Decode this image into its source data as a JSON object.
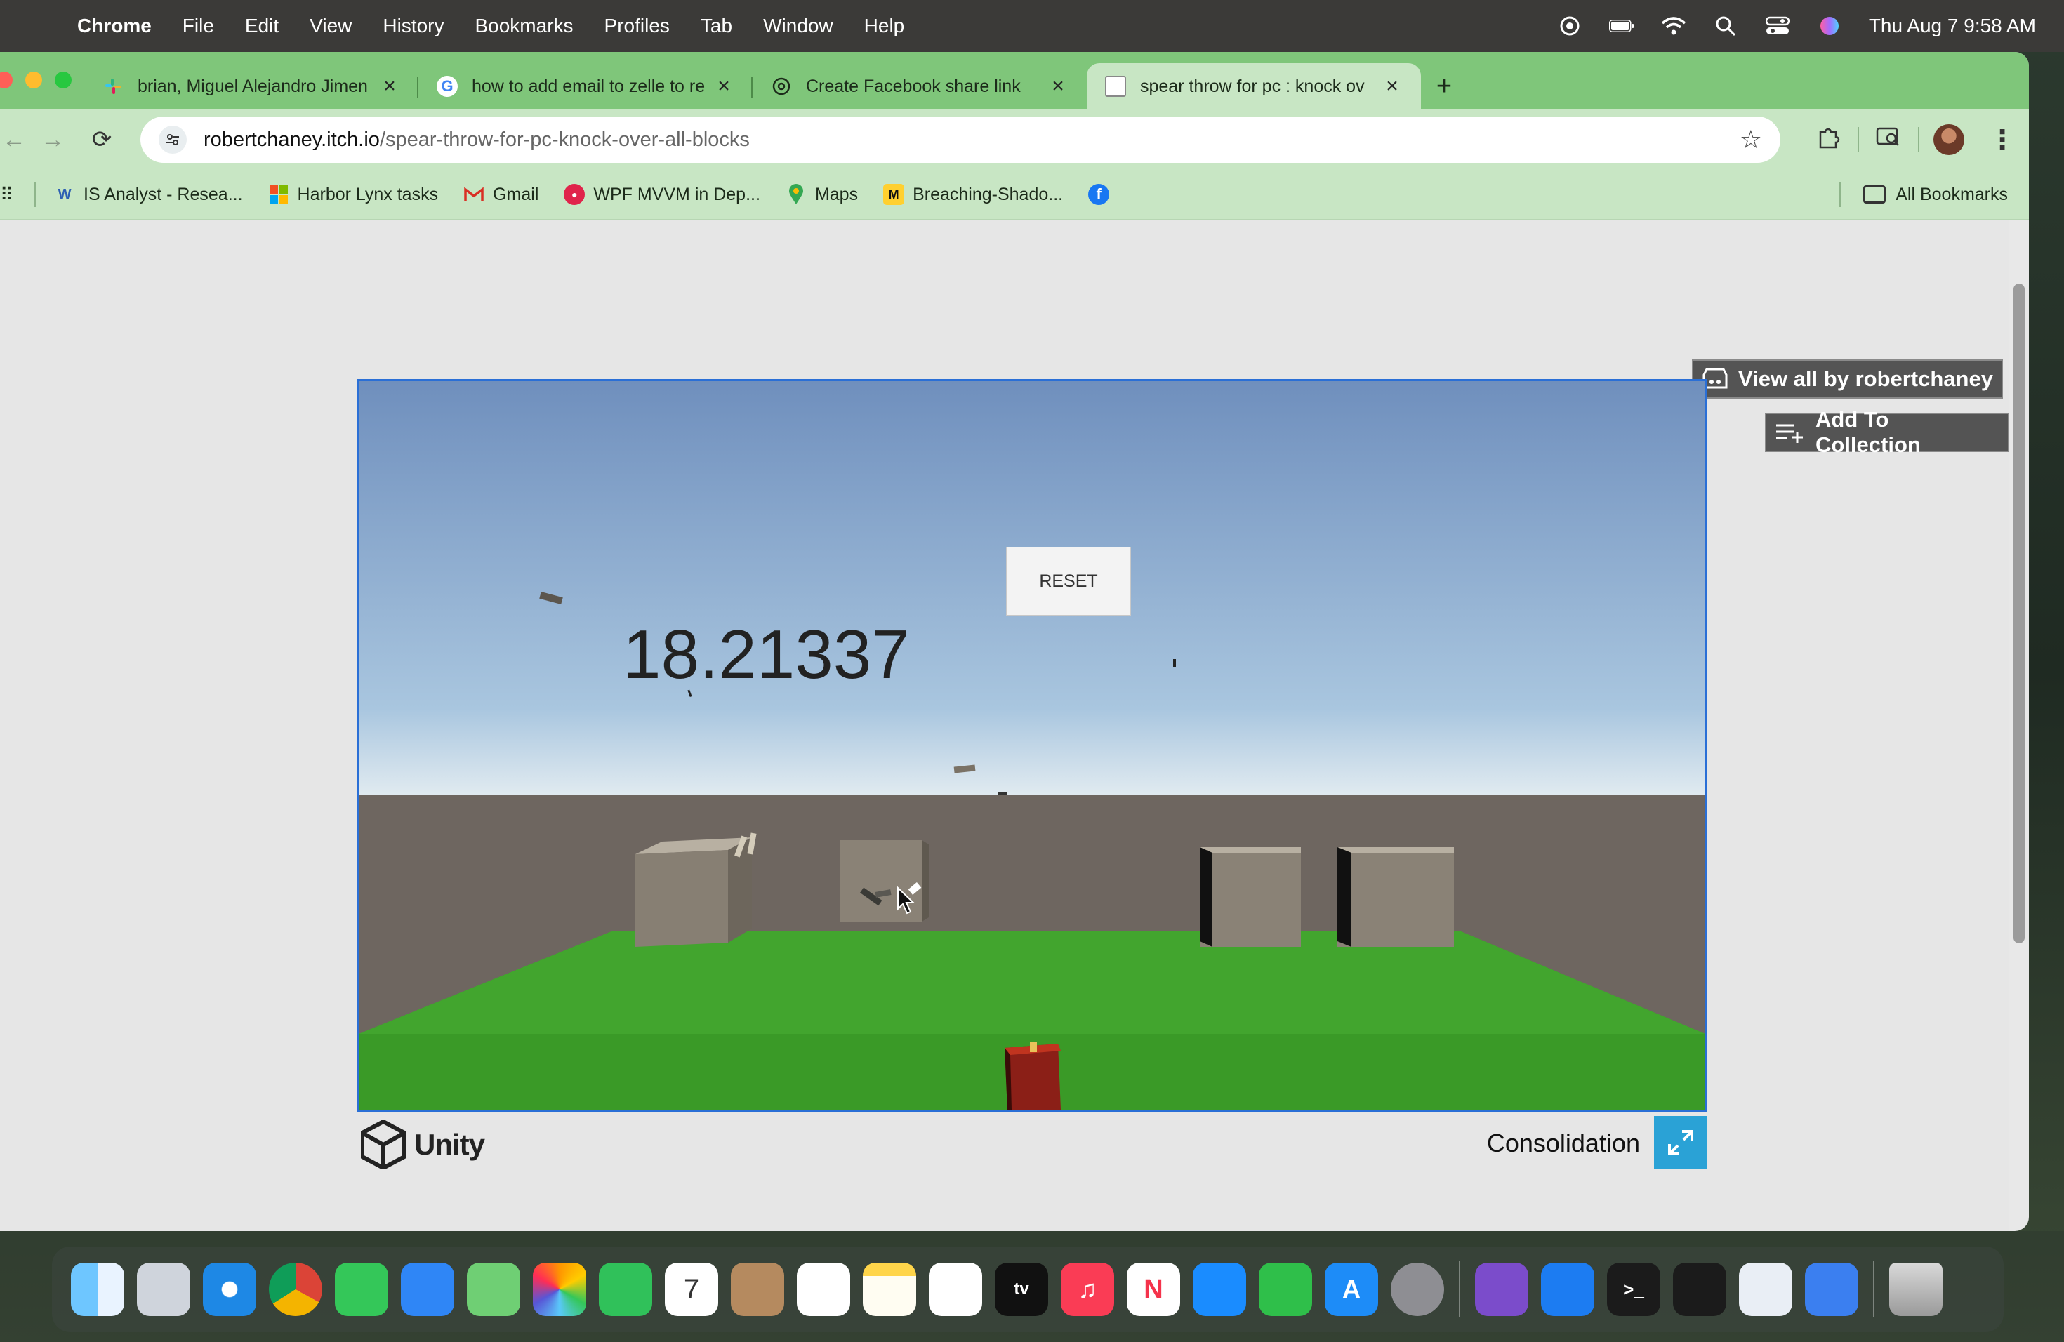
{
  "menubar": {
    "app": "Chrome",
    "items": [
      "File",
      "Edit",
      "View",
      "History",
      "Bookmarks",
      "Profiles",
      "Tab",
      "Window",
      "Help"
    ],
    "clock": "Thu Aug 7  9:58 AM"
  },
  "tabs": [
    {
      "title": "brian, Miguel Alejandro Jimen",
      "favicon": "slack-icon"
    },
    {
      "title": "how to add email to zelle to re",
      "favicon": "google-icon"
    },
    {
      "title": "Create Facebook share link",
      "favicon": "chatgpt-icon"
    },
    {
      "title": "spear throw for pc : knock ov",
      "favicon": "page-icon",
      "active": true
    }
  ],
  "omnibox": {
    "host": "robertchaney.itch.io",
    "path": "/spear-throw-for-pc-knock-over-all-blocks"
  },
  "bookmarks": [
    {
      "label": "IS Analyst - Resea...",
      "icon": "w-icon",
      "color": "#2b5fb3"
    },
    {
      "label": "Harbor Lynx tasks",
      "icon": "microsoft-icon",
      "color": "#f25022"
    },
    {
      "label": "Gmail",
      "icon": "gmail-icon",
      "color": "#d93025"
    },
    {
      "label": "WPF MVVM in Dep...",
      "icon": "red-circle-icon",
      "color": "#e0244b"
    },
    {
      "label": "Maps",
      "icon": "maps-pin-icon",
      "color": "#34a853"
    },
    {
      "label": "Breaching-Shado...",
      "icon": "miro-icon",
      "color": "#ffd02f"
    }
  ],
  "bookmarks_right": "All Bookmarks",
  "itch": {
    "view_all": "View all by robertchaney",
    "add_collection": "Add To Collection"
  },
  "game": {
    "reset_label": "RESET",
    "score": "18.21337",
    "engine": "Unity",
    "product_name": "Consolidation"
  },
  "colors": {
    "tab_strip": "#7fc67a",
    "toolbar": "#c8e6c4",
    "game_border": "#2a6fd6",
    "ground": "#3a9a27",
    "fullscreen": "#2aa2d6"
  }
}
